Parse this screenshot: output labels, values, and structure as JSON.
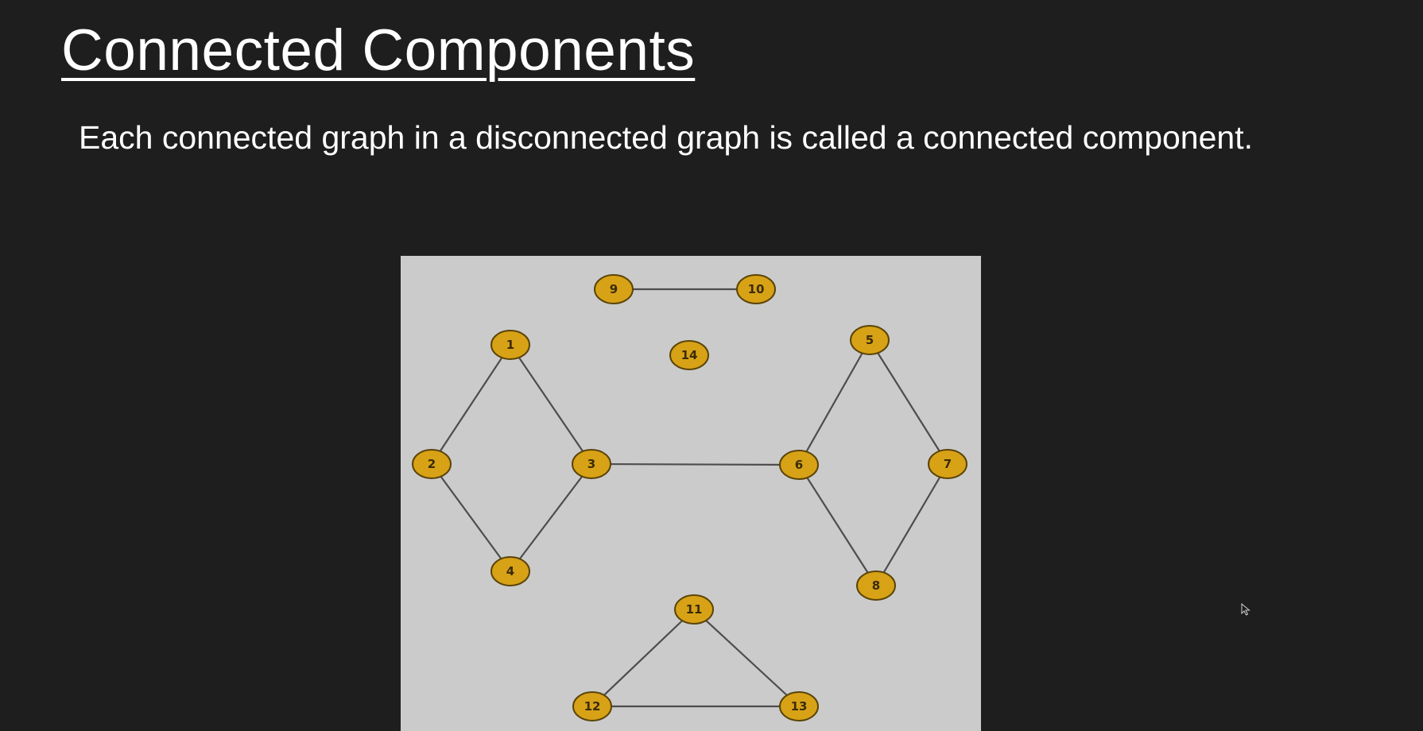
{
  "slide": {
    "title": "Connected Components",
    "subtitle": "Each connected graph in a disconnected graph is called a connected component."
  },
  "graph": {
    "node_color": "#d8a217",
    "edge_color": "#4d4d4d",
    "background": "#cbcbcb",
    "nodes": [
      "1",
      "2",
      "3",
      "4",
      "5",
      "6",
      "7",
      "8",
      "9",
      "10",
      "11",
      "12",
      "13",
      "14"
    ],
    "edges": [
      [
        "9",
        "10"
      ],
      [
        "1",
        "2"
      ],
      [
        "1",
        "3"
      ],
      [
        "2",
        "4"
      ],
      [
        "3",
        "4"
      ],
      [
        "3",
        "6"
      ],
      [
        "5",
        "6"
      ],
      [
        "5",
        "7"
      ],
      [
        "6",
        "8"
      ],
      [
        "7",
        "8"
      ],
      [
        "11",
        "12"
      ],
      [
        "11",
        "13"
      ],
      [
        "12",
        "13"
      ]
    ]
  },
  "cursor": {
    "icon": "mouse-pointer-icon"
  }
}
